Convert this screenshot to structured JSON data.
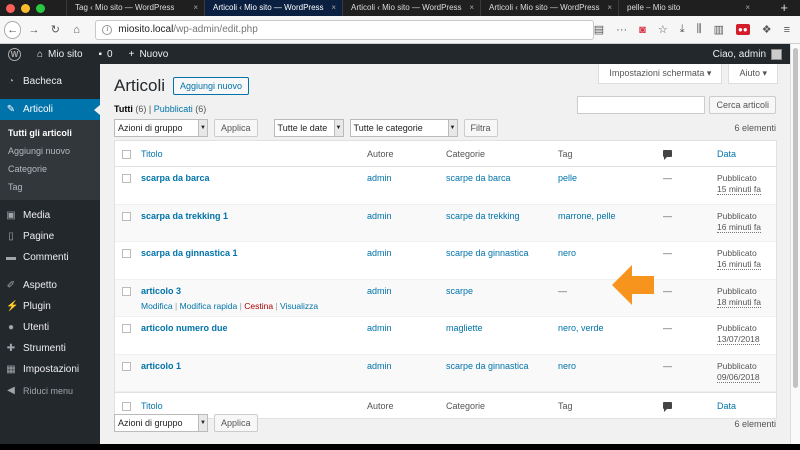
{
  "browser": {
    "tabs": [
      {
        "label": "Tag ‹ Mio sito — WordPress",
        "active": false
      },
      {
        "label": "Articoli ‹ Mio sito — WordPress",
        "active": true
      },
      {
        "label": "Articoli ‹ Mio sito — WordPress",
        "active": false
      },
      {
        "label": "Articoli ‹ Mio sito — WordPress",
        "active": false
      },
      {
        "label": "pelle – Mio sito",
        "active": false
      }
    ],
    "close_glyph": "×",
    "new_tab_glyph": "+",
    "url_host": "miosito.local",
    "url_path": "/wp-admin/edit.php",
    "ext_badge": "",
    "colors": {
      "close": "#fc5f57",
      "min": "#fdbc2e",
      "max": "#28c840"
    }
  },
  "adminbar": {
    "site_name": "Mio sito",
    "comments_count": "0",
    "new_label": "Nuovo",
    "greeting": "Ciao, admin"
  },
  "sidebar": {
    "items": [
      {
        "label": "Bacheca",
        "icon": "dashboard-icon"
      },
      {
        "label": "Articoli",
        "icon": "pin-icon"
      },
      {
        "label": "Media",
        "icon": "media-icon"
      },
      {
        "label": "Pagine",
        "icon": "page-icon"
      },
      {
        "label": "Commenti",
        "icon": "comment-icon"
      },
      {
        "label": "Aspetto",
        "icon": "brush-icon"
      },
      {
        "label": "Plugin",
        "icon": "plug-icon"
      },
      {
        "label": "Utenti",
        "icon": "user-icon"
      },
      {
        "label": "Strumenti",
        "icon": "wrench-icon"
      },
      {
        "label": "Impostazioni",
        "icon": "settings-icon"
      }
    ],
    "sub_items": [
      "Tutti gli articoli",
      "Aggiungi nuovo",
      "Categorie",
      "Tag"
    ],
    "collapse_label": "Riduci menu"
  },
  "page": {
    "title": "Articoli",
    "add_new": "Aggiungi nuovo",
    "screen_options": "Impostazioni schermata ▾",
    "help": "Aiuto ▾",
    "filter_all": "Tutti",
    "filter_all_count": "(6)",
    "filter_sep": "|",
    "filter_published": "Pubblicati",
    "filter_published_count": "(6)",
    "search_button": "Cerca articoli",
    "bulk_actions": "Azioni di gruppo",
    "apply": "Applica",
    "all_dates": "Tutte le date",
    "all_categories": "Tutte le categorie",
    "filter_button": "Filtra",
    "items_count": "6 elementi"
  },
  "table": {
    "headers": {
      "title": "Titolo",
      "author": "Autore",
      "categories": "Categorie",
      "tags": "Tag",
      "date": "Data"
    },
    "rows": [
      {
        "title": "scarpa da barca",
        "author": "admin",
        "categories": "scarpe da barca",
        "tags": "pelle",
        "comments": "—",
        "status": "Pubblicato",
        "date": "15 minuti fa"
      },
      {
        "title": "scarpa da trekking 1",
        "author": "admin",
        "categories": "scarpe da trekking",
        "tags": "marrone, pelle",
        "comments": "—",
        "status": "Pubblicato",
        "date": "16 minuti fa"
      },
      {
        "title": "scarpa da ginnastica 1",
        "author": "admin",
        "categories": "scarpe da ginnastica",
        "tags": "nero",
        "comments": "—",
        "status": "Pubblicato",
        "date": "16 minuti fa"
      },
      {
        "title": "articolo 3",
        "author": "admin",
        "categories": "scarpe",
        "tags": "—",
        "comments": "—",
        "status": "Pubblicato",
        "date": "18 minuti fa"
      },
      {
        "title": "articolo numero due",
        "author": "admin",
        "categories": "magliette",
        "tags": "nero, verde",
        "comments": "—",
        "status": "Pubblicato",
        "date": "13/07/2018"
      },
      {
        "title": "articolo 1",
        "author": "admin",
        "categories": "scarpe da ginnastica",
        "tags": "nero",
        "comments": "—",
        "status": "Pubblicato",
        "date": "09/06/2018"
      }
    ],
    "row_actions": {
      "edit": "Modifica",
      "quick_edit": "Modifica rapida",
      "trash": "Cestina",
      "view": "Visualizza",
      "sep": "|"
    }
  },
  "colors": {
    "wp_blue": "#0073aa",
    "admin_dark": "#23282d",
    "arrow": "#f7941d"
  }
}
